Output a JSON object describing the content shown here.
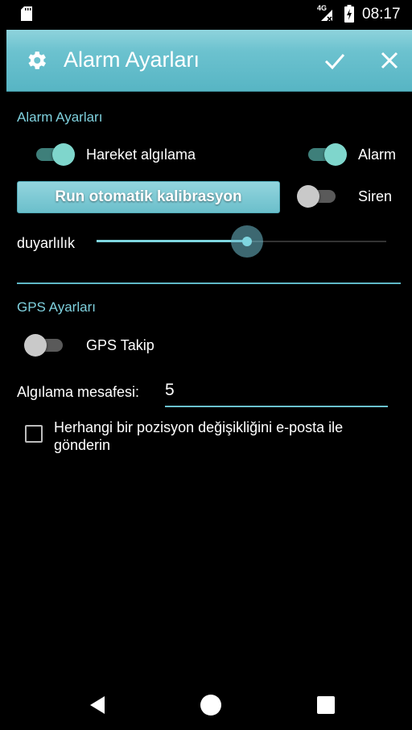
{
  "status_bar": {
    "time": "08:17",
    "network": "4G"
  },
  "app_bar": {
    "title": "Alarm Ayarları"
  },
  "alarm_section": {
    "title": "Alarm Ayarları",
    "motion_detection": {
      "label": "Hareket algılama",
      "checked": true
    },
    "alarm": {
      "label": "Alarm",
      "checked": true
    },
    "calibration_button": "Run otomatik kalibrasyon",
    "siren": {
      "label": "Siren",
      "checked": false
    },
    "sensitivity": {
      "label": "duyarlılık",
      "value_fraction": 0.52
    }
  },
  "gps_section": {
    "title": "GPS Ayarları",
    "gps_tracking": {
      "label": "GPS Takip",
      "checked": false
    },
    "detection_distance": {
      "label": "Algılama mesafesi:",
      "value": "5"
    },
    "email_on_change": {
      "label": "Herhangi bir pozisyon değişikliğini e-posta ile gönderin",
      "checked": false
    }
  },
  "colors": {
    "accent": "#7fd1de",
    "appbar": "#6cc2cf",
    "switch_on_thumb": "#7fd6cc"
  },
  "icons": {
    "status": [
      "sd-card-icon",
      "network-4g-icon",
      "battery-charging-icon"
    ],
    "appbar": [
      "gear-icon",
      "check-icon",
      "close-icon"
    ],
    "nav": [
      "back-icon",
      "home-icon",
      "recents-icon"
    ]
  }
}
